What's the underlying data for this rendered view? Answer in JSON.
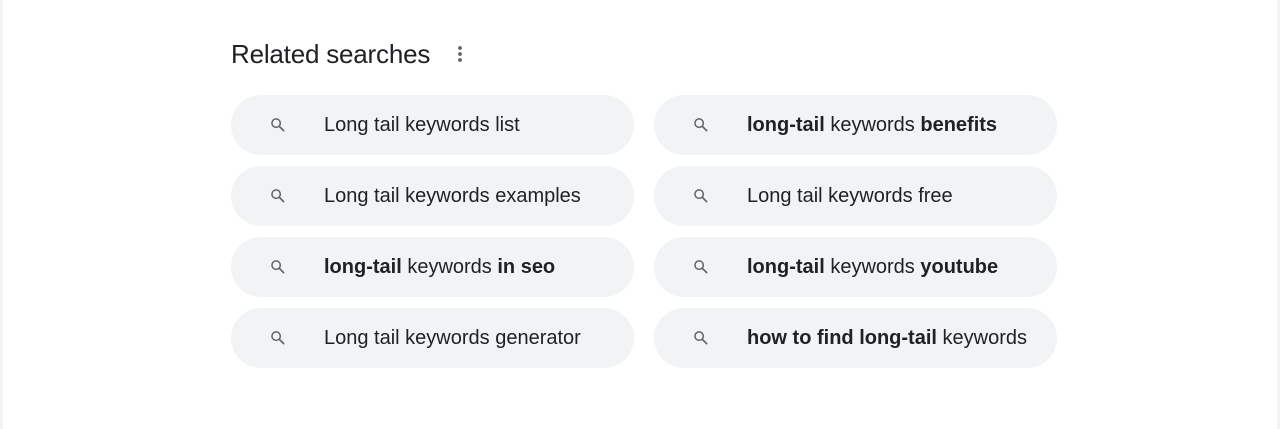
{
  "related": {
    "title": "Related searches",
    "more_icon": "more-vert-icon",
    "chip_icon": "search-icon",
    "colors": {
      "chip_background": "#f1f3f4",
      "text": "#202124",
      "icon": "#5f6368"
    },
    "items": [
      {
        "label": "Long tail keywords list",
        "segments": [
          {
            "text": "Long tail keywords list",
            "bold": false
          }
        ]
      },
      {
        "label": "long-tail keywords benefits",
        "segments": [
          {
            "text": "long-tail",
            "bold": true
          },
          {
            "text": " keywords ",
            "bold": false
          },
          {
            "text": "benefits",
            "bold": true
          }
        ]
      },
      {
        "label": "Long tail keywords examples",
        "segments": [
          {
            "text": "Long tail keywords examples",
            "bold": false
          }
        ]
      },
      {
        "label": "Long tail keywords free",
        "segments": [
          {
            "text": "Long tail keywords free",
            "bold": false
          }
        ]
      },
      {
        "label": "long-tail keywords in seo",
        "segments": [
          {
            "text": "long-tail",
            "bold": true
          },
          {
            "text": " keywords ",
            "bold": false
          },
          {
            "text": "in seo",
            "bold": true
          }
        ]
      },
      {
        "label": "long-tail keywords youtube",
        "segments": [
          {
            "text": "long-tail",
            "bold": true
          },
          {
            "text": " keywords ",
            "bold": false
          },
          {
            "text": "youtube",
            "bold": true
          }
        ]
      },
      {
        "label": "Long tail keywords generator",
        "segments": [
          {
            "text": "Long tail keywords generator",
            "bold": false
          }
        ]
      },
      {
        "label": "how to find long-tail keywords",
        "segments": [
          {
            "text": "how to find long-tail",
            "bold": true
          },
          {
            "text": " keywords",
            "bold": false
          }
        ]
      }
    ]
  }
}
